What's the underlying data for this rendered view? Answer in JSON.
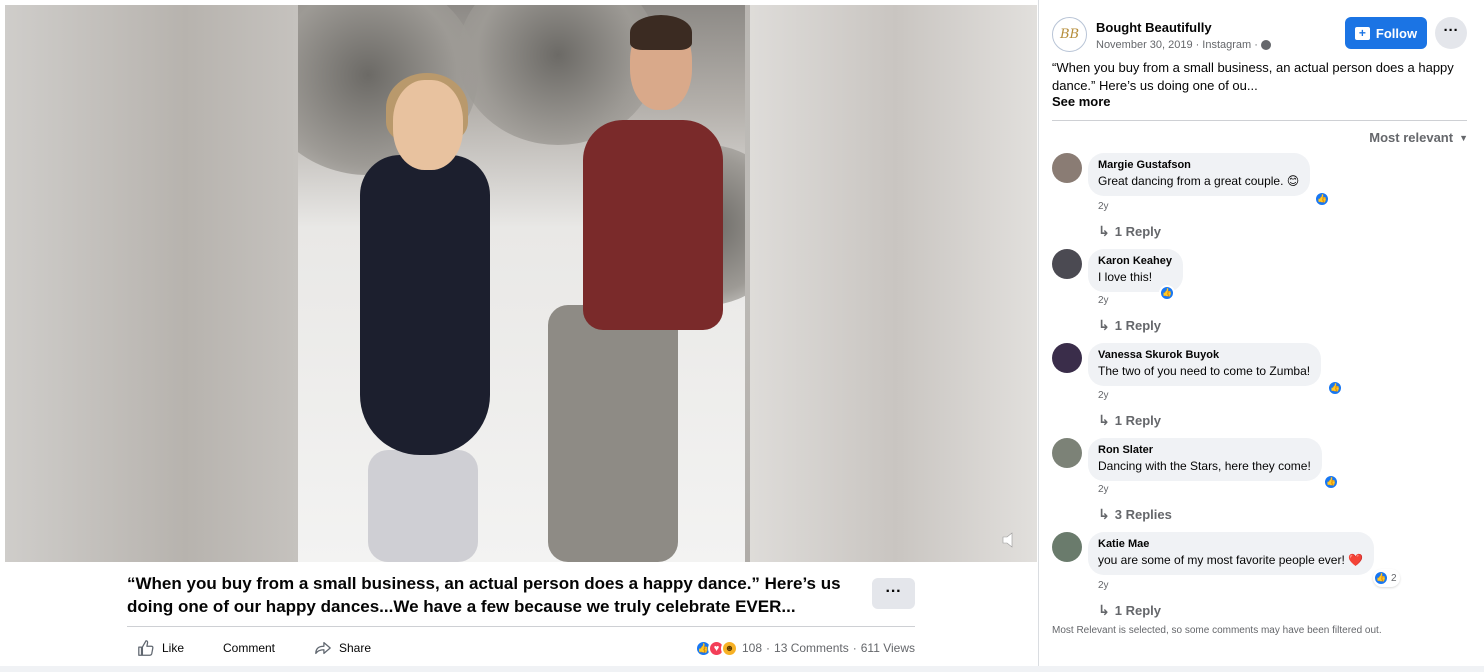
{
  "video": {
    "mute_icon": "speaker-muted-icon"
  },
  "post": {
    "caption": "“When you buy from a small business, an actual person does a happy dance.” Here’s us doing one of our happy dances...We have a few because we truly celebrate EVER...",
    "more_label": "···",
    "actions": {
      "like": "Like",
      "comment": "Comment",
      "share": "Share"
    },
    "reactions": {
      "count": "108",
      "comments": "13 Comments",
      "views": "611 Views",
      "separator": "·"
    }
  },
  "sidebar": {
    "avatar_text": "BB",
    "page_name": "Bought Beautifully",
    "date": "November 30, 2019",
    "source": "Instagram",
    "meta_sep": "·",
    "follow_label": "Follow",
    "dots_label": "···",
    "text": "“When you buy from a small business, an actual person does a happy dance.” Here’s us doing one of ou...",
    "see_more": "See more",
    "sort_label": "Most relevant",
    "comments": [
      {
        "name": "Margie Gustafson",
        "text": "Great dancing from a great couple. 😊",
        "time": "2y",
        "replies": "1 Reply",
        "avatar_color": "#8a7c74"
      },
      {
        "name": "Karon Keahey",
        "text": "I love this!",
        "time": "2y",
        "replies": "1 Reply",
        "avatar_color": "#4b4a52"
      },
      {
        "name": "Vanessa Skurok Buyok",
        "text": "The two of you need to come to Zumba!",
        "time": "2y",
        "replies": "1 Reply",
        "avatar_color": "#3a2d4a"
      },
      {
        "name": "Ron Slater",
        "text": "Dancing with the Stars, here they come!",
        "time": "2y",
        "replies": "3 Replies",
        "avatar_color": "#7c8277"
      },
      {
        "name": "Katie Mae",
        "text": "you are some of my most favorite people ever! ❤️",
        "time": "2y",
        "replies": "1 Reply",
        "avatar_color": "#6a7b6c",
        "reaction_count": "2"
      }
    ],
    "footnote": "Most Relevant is selected, so some comments may have been filtered out."
  }
}
